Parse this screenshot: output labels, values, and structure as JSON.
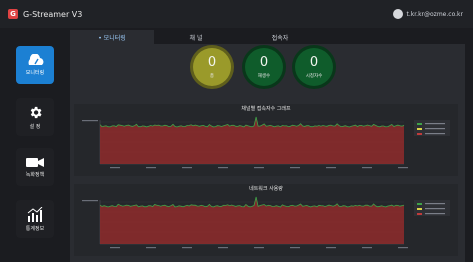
{
  "app": {
    "title": "G-Streamer V3",
    "logo_text": "G"
  },
  "user": {
    "email": "t.kr.kr@ozme.co.kr"
  },
  "sidebar": {
    "items": [
      {
        "label": "모니터링",
        "icon": "cloud-gauge-icon",
        "active": true
      },
      {
        "label": "설 정",
        "icon": "gear-icon",
        "active": false
      },
      {
        "label": "녹화정책",
        "icon": "camera-icon",
        "active": false
      },
      {
        "label": "통계정보",
        "icon": "bar-chart-icon",
        "active": false
      }
    ]
  },
  "tabs": [
    {
      "label": "• 모니터링",
      "active": true
    },
    {
      "label": "채 널",
      "active": false
    },
    {
      "label": "접속자",
      "active": false
    }
  ],
  "stats": [
    {
      "value": "0",
      "label": "총",
      "color": "#9a9a2a"
    },
    {
      "value": "0",
      "label": "재생수",
      "color": "#0f5c2b"
    },
    {
      "value": "0",
      "label": "시청자수",
      "color": "#0f5c2b"
    }
  ],
  "panels": [
    {
      "title": "채널별 접속자수 그래프"
    },
    {
      "title": "네트워크 사용량"
    }
  ],
  "colors": {
    "accent": "#1c80d3",
    "area_fill": "#8f2b2b",
    "area_line": "#3fa348",
    "topbar": "#202226",
    "content": "#2a2c31"
  }
}
